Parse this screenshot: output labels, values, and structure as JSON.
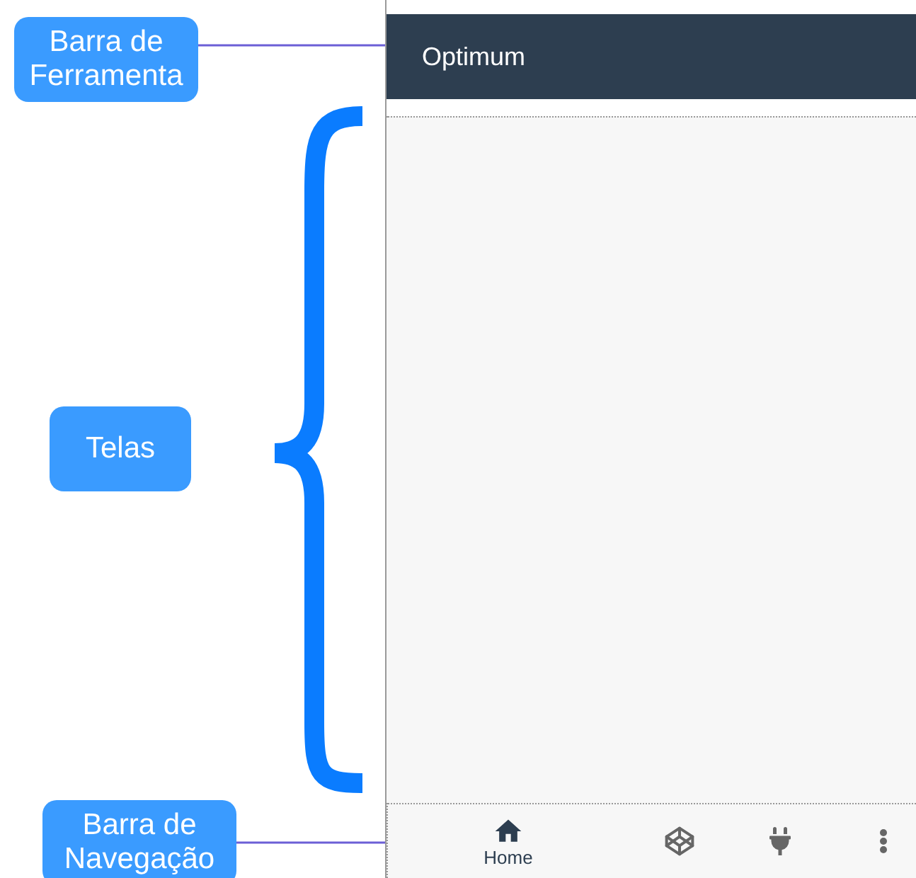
{
  "annotations": [
    {
      "text": "Barra de Ferramenta"
    },
    {
      "text": "Telas"
    },
    {
      "text": "Barra de Navegação"
    }
  ],
  "app": {
    "toolbar": {
      "title": "Optimum"
    },
    "nav": [
      {
        "label": "Home",
        "selected": true
      },
      {
        "selected": false
      },
      {
        "selected": false
      },
      {
        "selected": false
      }
    ]
  }
}
